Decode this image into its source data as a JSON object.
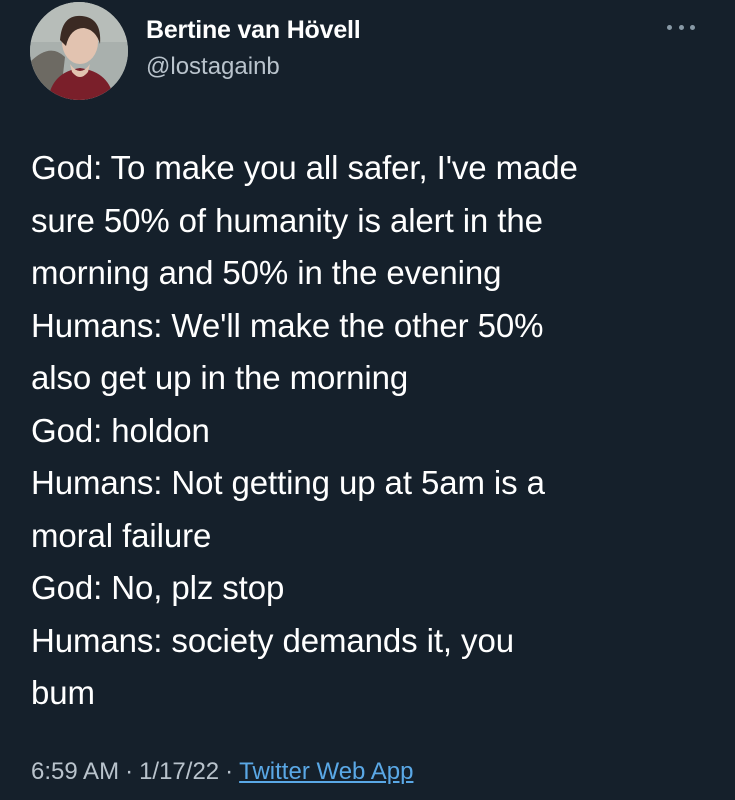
{
  "author": {
    "display_name": "Bertine van Hövell",
    "handle": "@lostagainb"
  },
  "menu_icon": "more-horizontal-icon",
  "tweet": {
    "lines": [
      "God: To make you all safer, I've made",
      "sure 50% of humanity is alert in the",
      "morning and 50% in the evening",
      "Humans: We'll make the other 50%",
      "also get up in the morning",
      "God: holdon",
      "Humans: Not getting up at 5am is a",
      "moral failure",
      "God: No, plz stop",
      "Humans: society demands it, you",
      "bum"
    ]
  },
  "meta": {
    "time": "6:59 AM",
    "separator": "·",
    "date": "1/17/22",
    "source": "Twitter Web App"
  },
  "colors": {
    "background": "#15202b",
    "text": "#ffffff",
    "secondary": "#b9c3cc",
    "link": "#5aa8e6"
  }
}
